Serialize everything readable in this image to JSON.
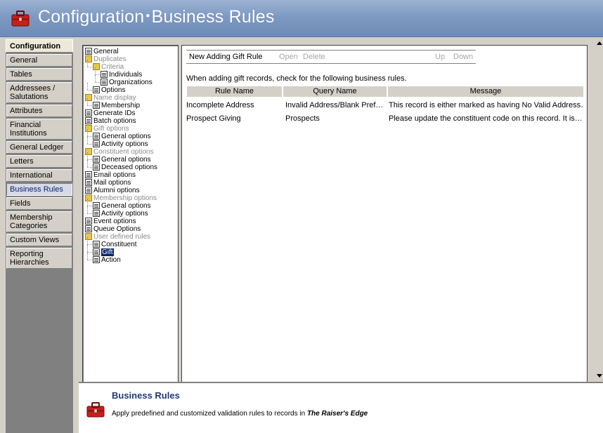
{
  "title": {
    "part1": "Configuration",
    "separator": "•",
    "part2": "Business Rules",
    "icon": "toolbox-icon"
  },
  "nav": {
    "header": "Configuration",
    "items": [
      {
        "label": "General"
      },
      {
        "label": "Tables"
      },
      {
        "label": "Addressees / Salutations"
      },
      {
        "label": "Attributes"
      },
      {
        "label": "Financial Institutions"
      },
      {
        "label": "General Ledger"
      },
      {
        "label": "Letters"
      },
      {
        "label": "International"
      },
      {
        "label": "Business Rules",
        "active": true
      },
      {
        "label": "Fields"
      },
      {
        "label": "Membership Categories"
      },
      {
        "label": "Custom Views"
      },
      {
        "label": "Reporting Hierarchies"
      }
    ]
  },
  "tree": [
    {
      "label": "General",
      "level": 0,
      "icon": "document-icon"
    },
    {
      "label": "Duplicates",
      "level": 0,
      "icon": "folder-icon",
      "grey": true
    },
    {
      "label": "Criteria",
      "level": 1,
      "icon": "folder-icon",
      "grey": true
    },
    {
      "label": "Individuals",
      "level": 2,
      "icon": "document-icon"
    },
    {
      "label": "Organizations",
      "level": 2,
      "icon": "document-icon"
    },
    {
      "label": "Options",
      "level": 1,
      "icon": "document-icon"
    },
    {
      "label": "Name display",
      "level": 0,
      "icon": "folder-icon",
      "grey": true
    },
    {
      "label": "Membership",
      "level": 1,
      "icon": "document-icon"
    },
    {
      "label": "Generate IDs",
      "level": 0,
      "icon": "document-icon"
    },
    {
      "label": "Batch options",
      "level": 0,
      "icon": "document-icon"
    },
    {
      "label": "Gift options",
      "level": 0,
      "icon": "folder-icon",
      "grey": true
    },
    {
      "label": "General options",
      "level": 1,
      "icon": "document-icon"
    },
    {
      "label": "Activity options",
      "level": 1,
      "icon": "document-icon"
    },
    {
      "label": "Constituent options",
      "level": 0,
      "icon": "folder-icon",
      "grey": true
    },
    {
      "label": "General options",
      "level": 1,
      "icon": "document-icon"
    },
    {
      "label": "Deceased options",
      "level": 1,
      "icon": "document-icon"
    },
    {
      "label": "Email options",
      "level": 0,
      "icon": "document-icon"
    },
    {
      "label": "Mail options",
      "level": 0,
      "icon": "document-icon"
    },
    {
      "label": "Alumni options",
      "level": 0,
      "icon": "document-icon"
    },
    {
      "label": "Membership options",
      "level": 0,
      "icon": "folder-icon",
      "grey": true
    },
    {
      "label": "General options",
      "level": 1,
      "icon": "document-icon"
    },
    {
      "label": "Activity options",
      "level": 1,
      "icon": "document-icon"
    },
    {
      "label": "Event options",
      "level": 0,
      "icon": "document-icon"
    },
    {
      "label": "Queue Options",
      "level": 0,
      "icon": "document-icon"
    },
    {
      "label": "User defined rules",
      "level": 0,
      "icon": "folder-icon",
      "grey": true
    },
    {
      "label": "Constituent",
      "level": 1,
      "icon": "document-icon"
    },
    {
      "label": "Gift",
      "level": 1,
      "icon": "document-icon",
      "selected": true
    },
    {
      "label": "Action",
      "level": 1,
      "icon": "document-icon"
    }
  ],
  "toolbar": {
    "new": "New Adding Gift Rule",
    "open": "Open",
    "delete": "Delete",
    "up": "Up",
    "down": "Down"
  },
  "intro": "When adding gift records, check for the following business rules.",
  "grid": {
    "headers": [
      "Rule Name",
      "Query Name",
      "Message"
    ],
    "rows": [
      [
        "Incomplete Address",
        "Invalid Address/Blank Pref…",
        "This record is either marked as having No Valid Address…"
      ],
      [
        "Prospect Giving",
        "Prospects",
        "Please update the constituent code on this record.  It is…"
      ]
    ]
  },
  "bottom": {
    "heading": "Business Rules",
    "description": "Apply predefined and customized validation rules to records in",
    "product": "The Raiser's Edge",
    "icon": "toolbox-icon"
  },
  "colors": {
    "titlebar": "#7e9ac3",
    "nav_bg": "#808080",
    "selection": "#0a246a",
    "heading": "#1f3a74"
  }
}
